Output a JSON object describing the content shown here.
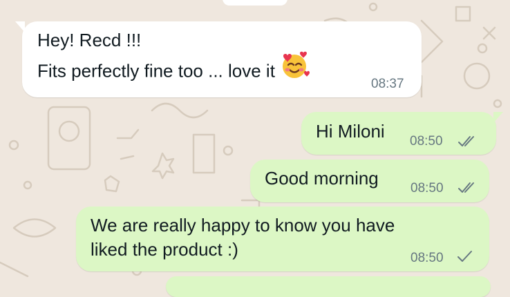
{
  "messages": [
    {
      "direction": "incoming",
      "lines": [
        "Hey! Recd !!!",
        "Fits perfectly fine too ... love it"
      ],
      "emoji": "smiling-face-with-hearts",
      "time": "08:37"
    },
    {
      "direction": "outgoing",
      "lines": [
        "Hi Miloni"
      ],
      "time": "08:50",
      "status": "read"
    },
    {
      "direction": "outgoing",
      "lines": [
        "Good morning"
      ],
      "time": "08:50",
      "status": "read"
    },
    {
      "direction": "outgoing",
      "lines": [
        "We are really happy to know you have",
        "liked the product :)"
      ],
      "time": "08:50",
      "status": "sent"
    }
  ],
  "colors": {
    "wallpaper": "#efe7de",
    "incoming_bubble": "#ffffff",
    "outgoing_bubble": "#dcf7c5",
    "tick_read": "#667781"
  }
}
